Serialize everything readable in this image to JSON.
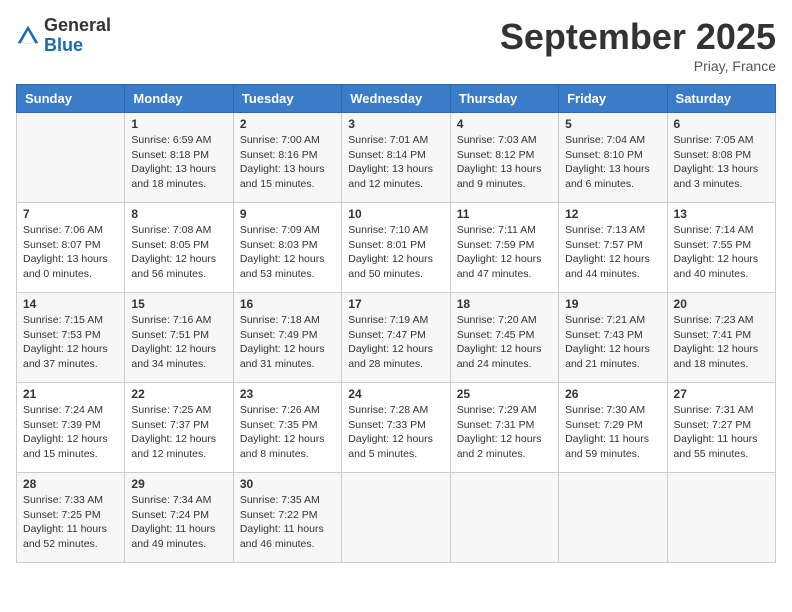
{
  "header": {
    "logo_line1": "General",
    "logo_line2": "Blue",
    "month_title": "September 2025",
    "location": "Priay, France"
  },
  "days_of_week": [
    "Sunday",
    "Monday",
    "Tuesday",
    "Wednesday",
    "Thursday",
    "Friday",
    "Saturday"
  ],
  "weeks": [
    [
      {
        "day": "",
        "content": ""
      },
      {
        "day": "1",
        "content": "Sunrise: 6:59 AM\nSunset: 8:18 PM\nDaylight: 13 hours\nand 18 minutes."
      },
      {
        "day": "2",
        "content": "Sunrise: 7:00 AM\nSunset: 8:16 PM\nDaylight: 13 hours\nand 15 minutes."
      },
      {
        "day": "3",
        "content": "Sunrise: 7:01 AM\nSunset: 8:14 PM\nDaylight: 13 hours\nand 12 minutes."
      },
      {
        "day": "4",
        "content": "Sunrise: 7:03 AM\nSunset: 8:12 PM\nDaylight: 13 hours\nand 9 minutes."
      },
      {
        "day": "5",
        "content": "Sunrise: 7:04 AM\nSunset: 8:10 PM\nDaylight: 13 hours\nand 6 minutes."
      },
      {
        "day": "6",
        "content": "Sunrise: 7:05 AM\nSunset: 8:08 PM\nDaylight: 13 hours\nand 3 minutes."
      }
    ],
    [
      {
        "day": "7",
        "content": "Sunrise: 7:06 AM\nSunset: 8:07 PM\nDaylight: 13 hours\nand 0 minutes."
      },
      {
        "day": "8",
        "content": "Sunrise: 7:08 AM\nSunset: 8:05 PM\nDaylight: 12 hours\nand 56 minutes."
      },
      {
        "day": "9",
        "content": "Sunrise: 7:09 AM\nSunset: 8:03 PM\nDaylight: 12 hours\nand 53 minutes."
      },
      {
        "day": "10",
        "content": "Sunrise: 7:10 AM\nSunset: 8:01 PM\nDaylight: 12 hours\nand 50 minutes."
      },
      {
        "day": "11",
        "content": "Sunrise: 7:11 AM\nSunset: 7:59 PM\nDaylight: 12 hours\nand 47 minutes."
      },
      {
        "day": "12",
        "content": "Sunrise: 7:13 AM\nSunset: 7:57 PM\nDaylight: 12 hours\nand 44 minutes."
      },
      {
        "day": "13",
        "content": "Sunrise: 7:14 AM\nSunset: 7:55 PM\nDaylight: 12 hours\nand 40 minutes."
      }
    ],
    [
      {
        "day": "14",
        "content": "Sunrise: 7:15 AM\nSunset: 7:53 PM\nDaylight: 12 hours\nand 37 minutes."
      },
      {
        "day": "15",
        "content": "Sunrise: 7:16 AM\nSunset: 7:51 PM\nDaylight: 12 hours\nand 34 minutes."
      },
      {
        "day": "16",
        "content": "Sunrise: 7:18 AM\nSunset: 7:49 PM\nDaylight: 12 hours\nand 31 minutes."
      },
      {
        "day": "17",
        "content": "Sunrise: 7:19 AM\nSunset: 7:47 PM\nDaylight: 12 hours\nand 28 minutes."
      },
      {
        "day": "18",
        "content": "Sunrise: 7:20 AM\nSunset: 7:45 PM\nDaylight: 12 hours\nand 24 minutes."
      },
      {
        "day": "19",
        "content": "Sunrise: 7:21 AM\nSunset: 7:43 PM\nDaylight: 12 hours\nand 21 minutes."
      },
      {
        "day": "20",
        "content": "Sunrise: 7:23 AM\nSunset: 7:41 PM\nDaylight: 12 hours\nand 18 minutes."
      }
    ],
    [
      {
        "day": "21",
        "content": "Sunrise: 7:24 AM\nSunset: 7:39 PM\nDaylight: 12 hours\nand 15 minutes."
      },
      {
        "day": "22",
        "content": "Sunrise: 7:25 AM\nSunset: 7:37 PM\nDaylight: 12 hours\nand 12 minutes."
      },
      {
        "day": "23",
        "content": "Sunrise: 7:26 AM\nSunset: 7:35 PM\nDaylight: 12 hours\nand 8 minutes."
      },
      {
        "day": "24",
        "content": "Sunrise: 7:28 AM\nSunset: 7:33 PM\nDaylight: 12 hours\nand 5 minutes."
      },
      {
        "day": "25",
        "content": "Sunrise: 7:29 AM\nSunset: 7:31 PM\nDaylight: 12 hours\nand 2 minutes."
      },
      {
        "day": "26",
        "content": "Sunrise: 7:30 AM\nSunset: 7:29 PM\nDaylight: 11 hours\nand 59 minutes."
      },
      {
        "day": "27",
        "content": "Sunrise: 7:31 AM\nSunset: 7:27 PM\nDaylight: 11 hours\nand 55 minutes."
      }
    ],
    [
      {
        "day": "28",
        "content": "Sunrise: 7:33 AM\nSunset: 7:25 PM\nDaylight: 11 hours\nand 52 minutes."
      },
      {
        "day": "29",
        "content": "Sunrise: 7:34 AM\nSunset: 7:24 PM\nDaylight: 11 hours\nand 49 minutes."
      },
      {
        "day": "30",
        "content": "Sunrise: 7:35 AM\nSunset: 7:22 PM\nDaylight: 11 hours\nand 46 minutes."
      },
      {
        "day": "",
        "content": ""
      },
      {
        "day": "",
        "content": ""
      },
      {
        "day": "",
        "content": ""
      },
      {
        "day": "",
        "content": ""
      }
    ]
  ]
}
